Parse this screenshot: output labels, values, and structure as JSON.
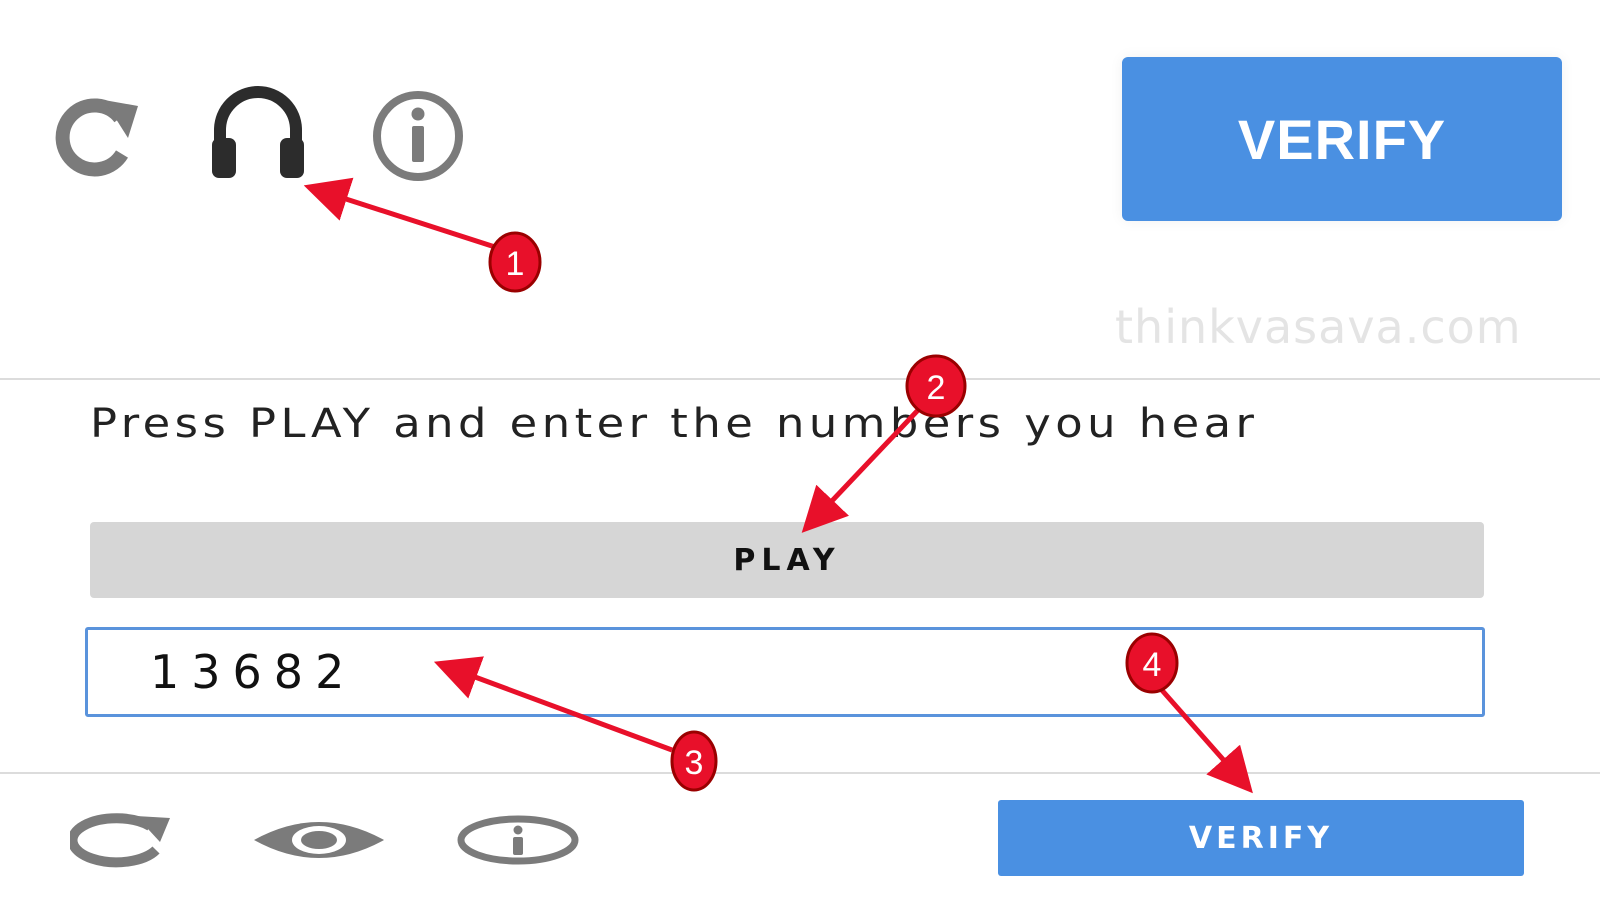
{
  "toolbar": {
    "icons": [
      "refresh-icon",
      "headphones-icon",
      "info-icon"
    ],
    "verify_label": "VERIFY"
  },
  "watermark": "thinkvasava.com",
  "audio_challenge": {
    "instructions": "Press PLAY and enter the numbers you hear",
    "play_label": "PLAY",
    "answer_value": "13682"
  },
  "footer": {
    "icons": [
      "refresh-icon",
      "eye-icon",
      "info-icon"
    ],
    "verify_label": "VERIFY"
  },
  "annotations": {
    "badges": [
      "1",
      "2",
      "3",
      "4"
    ],
    "color": "#e8102a"
  },
  "colors": {
    "accent": "#4a90e2",
    "play_bg": "#d6d6d6",
    "icon_gray": "#707070",
    "input_border": "#5a93dc"
  }
}
